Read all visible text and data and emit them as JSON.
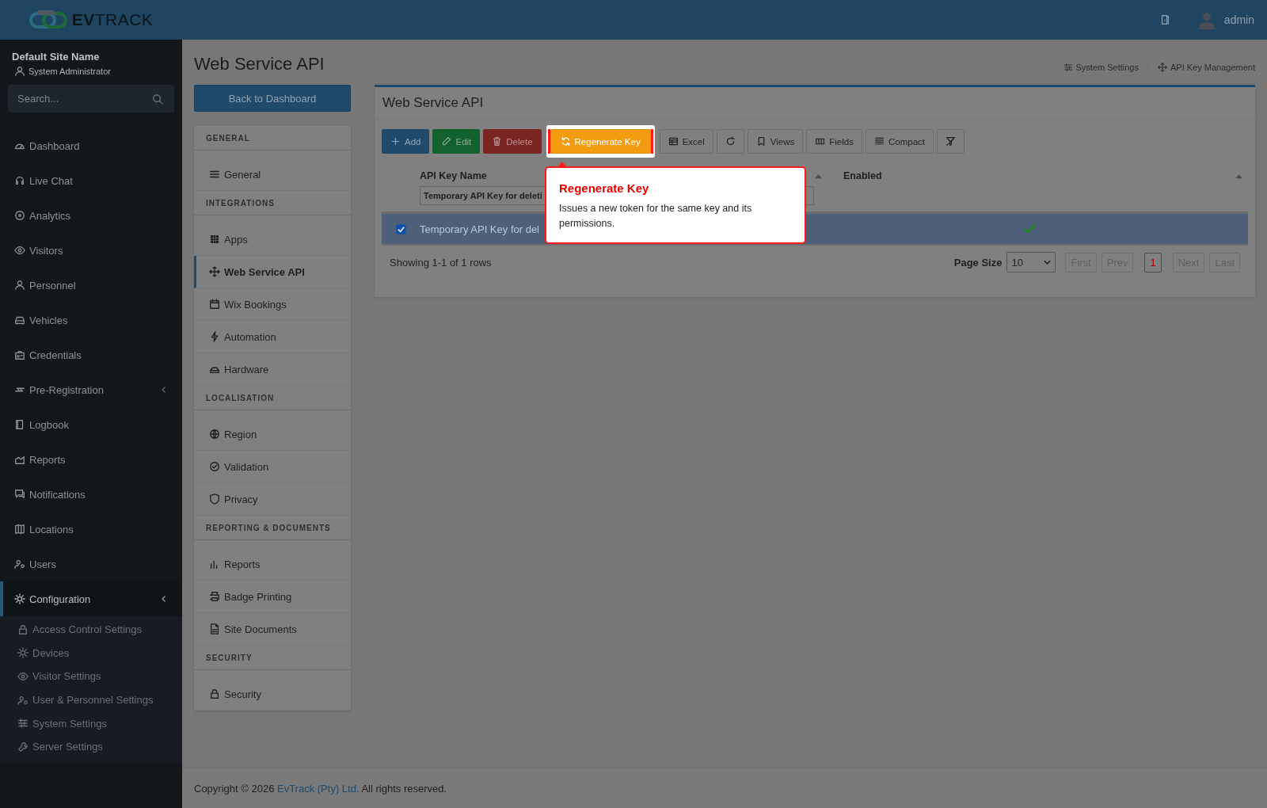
{
  "header": {
    "logo": "**EV**TRACK",
    "user": "admin"
  },
  "sidebar": {
    "site_name": "Default Site Name",
    "role": "System Administrator",
    "search": {
      "placeholder": "Search..."
    },
    "items": [
      {
        "label": "Dashboard",
        "selected": false
      },
      {
        "label": "Live Chat",
        "selected": false
      },
      {
        "label": "Analytics",
        "selected": false
      },
      {
        "label": "Visitors",
        "selected": false
      },
      {
        "label": "Personnel",
        "selected": false
      },
      {
        "label": "Vehicles",
        "selected": false
      },
      {
        "label": "Credentials",
        "selected": false
      },
      {
        "label": "Pre-Registration",
        "selected": false,
        "expanded": false
      },
      {
        "label": "Logbook",
        "selected": false
      },
      {
        "label": "Reports",
        "selected": false
      },
      {
        "label": "Notifications",
        "selected": false
      },
      {
        "label": "Locations",
        "selected": false
      },
      {
        "label": "Users",
        "selected": false
      },
      {
        "label": "Configuration",
        "selected": true,
        "expanded": true,
        "children": [
          "Access Control Settings",
          "Devices",
          "Visitor Settings",
          "User & Personnel Settings",
          "System Settings",
          "Server Settings"
        ]
      }
    ]
  },
  "page": {
    "title": "Web Service API",
    "back_button": "Back to Dashboard",
    "breadcrumb": [
      "System Settings",
      "API Key Management"
    ]
  },
  "settings_nav": [
    {
      "title": "GENERAL",
      "items": [
        {
          "label": "General",
          "selected": false
        }
      ]
    },
    {
      "title": "INTEGRATIONS",
      "items": [
        {
          "label": "Apps",
          "selected": false
        },
        {
          "label": "Web Service API",
          "selected": true
        },
        {
          "label": "Wix Bookings",
          "selected": false
        },
        {
          "label": "Automation",
          "selected": false
        },
        {
          "label": "Hardware",
          "selected": false
        }
      ]
    },
    {
      "title": "LOCALISATION",
      "items": [
        {
          "label": "Region",
          "selected": false
        },
        {
          "label": "Validation",
          "selected": false
        },
        {
          "label": "Privacy",
          "selected": false
        }
      ]
    },
    {
      "title": "REPORTING & DOCUMENTS",
      "items": [
        {
          "label": "Reports",
          "selected": false
        },
        {
          "label": "Badge Printing",
          "selected": false
        },
        {
          "label": "Site Documents",
          "selected": false
        }
      ]
    },
    {
      "title": "SECURITY",
      "items": [
        {
          "label": "Security",
          "selected": false
        }
      ]
    }
  ],
  "card": {
    "title": "Web Service API",
    "toolbar": [
      {
        "label": "Add",
        "kind": "primary",
        "highlighted": false
      },
      {
        "label": "Edit",
        "kind": "success",
        "highlighted": false
      },
      {
        "label": "Delete",
        "kind": "danger",
        "highlighted": false
      },
      {
        "label": "Regenerate Key",
        "kind": "warning",
        "highlighted": true
      },
      {
        "label": "Excel",
        "kind": "default",
        "highlighted": false
      },
      {
        "kind": "default",
        "highlighted": false
      },
      {
        "label": "Views",
        "kind": "default",
        "highlighted": false
      },
      {
        "label": "Fields",
        "kind": "default",
        "highlighted": false
      },
      {
        "label": "Compact",
        "kind": "default",
        "highlighted": false
      },
      {
        "kind": "default",
        "highlighted": false
      }
    ],
    "table": {
      "columns": [
        {
          "label": "API Key Name",
          "filter": "Temporary API Key for deleti"
        },
        {
          "label": "Enabled"
        }
      ],
      "rows": [
        {
          "selected": true,
          "name": "Temporary API Key for del",
          "enabled": true
        }
      ]
    },
    "summary": "Showing 1-1 of 1 rows",
    "pagination": {
      "page_size_label": "Page Size",
      "page_size": "10",
      "buttons": [
        {
          "label": "First",
          "selected": false,
          "disabled": true
        },
        {
          "label": "Prev",
          "selected": false,
          "disabled": true
        },
        {
          "label": "1",
          "selected": true,
          "disabled": false
        },
        {
          "label": "Next",
          "selected": false,
          "disabled": true
        },
        {
          "label": "Last",
          "selected": false,
          "disabled": true
        }
      ]
    }
  },
  "tour": {
    "title": "Regenerate Key",
    "text": "Issues a new token for the same key and its permissions."
  },
  "footer": {
    "before": "Copyright © 2026",
    "link": "EvTrack (Pty) Ltd.",
    "after": "All rights reserved."
  }
}
